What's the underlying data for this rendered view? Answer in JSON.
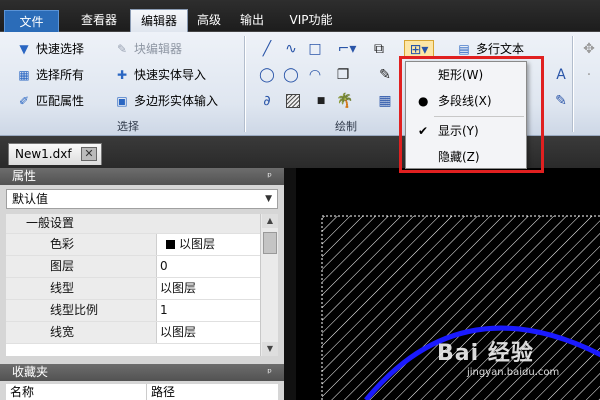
{
  "tabs": [
    {
      "label": "文件",
      "kind": "file"
    },
    {
      "label": "查看器",
      "kind": "normal"
    },
    {
      "label": "编辑器",
      "kind": "active"
    },
    {
      "label": "高级",
      "kind": "normal"
    },
    {
      "label": "输出",
      "kind": "normal"
    },
    {
      "label": "VIP功能",
      "kind": "normal"
    }
  ],
  "ribbon": {
    "select_group": {
      "label": "选择",
      "items": [
        {
          "label": "快速选择",
          "icon": "funnel-icon",
          "glyph": "▼",
          "enabled": true
        },
        {
          "label": "块编辑器",
          "icon": "block-editor-icon",
          "glyph": "✎",
          "enabled": false
        },
        {
          "label": "选择所有",
          "icon": "select-all-icon",
          "glyph": "▦",
          "enabled": true
        },
        {
          "label": "快速实体导入",
          "icon": "plus-icon",
          "glyph": "✚",
          "enabled": true
        },
        {
          "label": "匹配属性",
          "icon": "brush-icon",
          "glyph": "✐",
          "enabled": true
        },
        {
          "label": "多边形实体输入",
          "icon": "polygon-input-icon",
          "glyph": "▣",
          "enabled": true
        }
      ]
    },
    "draw_group": {
      "label": "绘制",
      "multiline_text_label": "多行文本"
    }
  },
  "document": {
    "tab_label": "New1.dxf",
    "close_glyph": "✕"
  },
  "properties_panel": {
    "title": "属性",
    "pin_glyph": "ᵖ",
    "dropdown_value": "默认值",
    "category": "一般设置",
    "rows": [
      {
        "name": "色彩",
        "value": "以图层",
        "swatch": "#000000"
      },
      {
        "name": "图层",
        "value": "0"
      },
      {
        "name": "线型",
        "value": "以图层"
      },
      {
        "name": "线型比例",
        "value": "1"
      },
      {
        "name": "线宽",
        "value": "以图层"
      }
    ]
  },
  "favorites_panel": {
    "title": "收藏夹",
    "col_name": "名称",
    "col_path": "路径"
  },
  "context_menu": {
    "items": [
      {
        "label": "矩形(W)",
        "mark": ""
      },
      {
        "label": "多段线(X)",
        "mark": "●"
      },
      {
        "label": "显示(Y)",
        "mark": "✔"
      },
      {
        "label": "隐藏(Z)",
        "mark": ""
      }
    ],
    "highlight_color": "#e02020"
  },
  "watermark": {
    "brand": "Bai 经验",
    "url": "jingyan.baidu.com"
  },
  "colors": {
    "arc": "#1a1aff",
    "hatch": "#ffffff",
    "file_tab": "#2b6cb8"
  }
}
